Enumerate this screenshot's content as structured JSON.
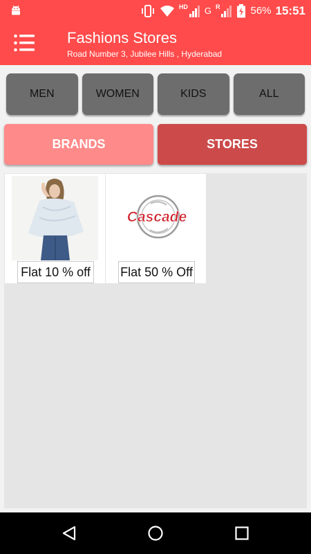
{
  "status_bar": {
    "battery_percent": "56%",
    "time": "15:51",
    "network_hd": "HD",
    "network_g": "G",
    "network_r": "R"
  },
  "header": {
    "title": "Fashions Stores",
    "subtitle": "Road Number 3, Jubilee Hills , Hyderabad"
  },
  "categories": [
    {
      "label": "MEN"
    },
    {
      "label": "WOMEN"
    },
    {
      "label": "KIDS"
    },
    {
      "label": "ALL"
    }
  ],
  "tabs": [
    {
      "label": "BRANDS",
      "active": false
    },
    {
      "label": "STORES",
      "active": true
    }
  ],
  "offers": [
    {
      "offer": "Flat 10 % off",
      "image": "woman-fashion-photo"
    },
    {
      "offer": "Flat 50 % Off",
      "image": "cascade-logo",
      "logo_text": "Cascade"
    }
  ],
  "colors": {
    "primary": "#ff4b4b",
    "brands_tab": "#ff8a8a",
    "stores_tab": "#cc4a4a",
    "category_button": "#6d6d6d"
  }
}
